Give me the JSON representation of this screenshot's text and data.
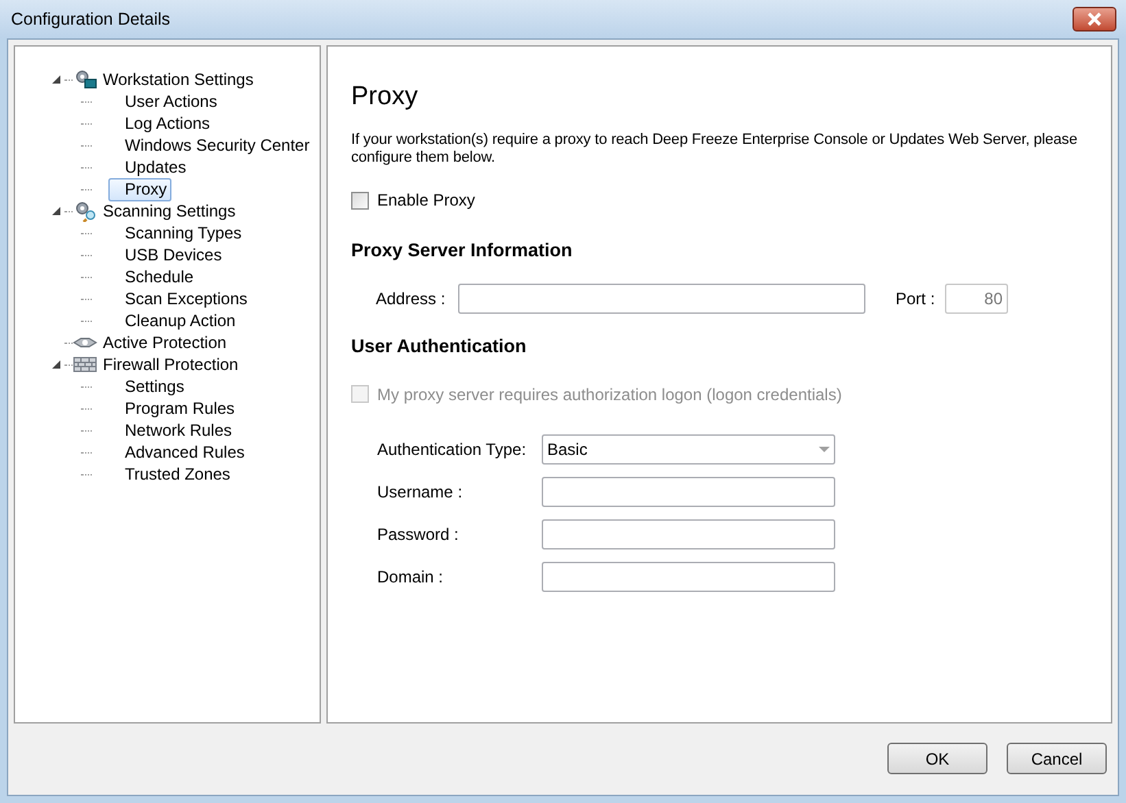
{
  "window": {
    "title": "Configuration Details"
  },
  "tree": [
    {
      "label": "Workstation Settings",
      "kind": "workstation",
      "expanded": true,
      "selected": false,
      "children": [
        {
          "label": "User Actions",
          "selected": false
        },
        {
          "label": "Log Actions",
          "selected": false
        },
        {
          "label": "Windows Security Center",
          "selected": false
        },
        {
          "label": "Updates",
          "selected": false
        },
        {
          "label": "Proxy",
          "selected": true
        }
      ]
    },
    {
      "label": "Scanning Settings",
      "kind": "scanning",
      "expanded": true,
      "selected": false,
      "children": [
        {
          "label": "Scanning Types",
          "selected": false
        },
        {
          "label": "USB Devices",
          "selected": false
        },
        {
          "label": "Schedule",
          "selected": false
        },
        {
          "label": "Scan Exceptions",
          "selected": false
        },
        {
          "label": "Cleanup Action",
          "selected": false
        }
      ]
    },
    {
      "label": "Active Protection",
      "kind": "active",
      "selected": false
    },
    {
      "label": "Firewall Protection",
      "kind": "firewall",
      "expanded": true,
      "selected": false,
      "children": [
        {
          "label": "Settings",
          "selected": false
        },
        {
          "label": "Program Rules",
          "selected": false
        },
        {
          "label": "Network Rules",
          "selected": false
        },
        {
          "label": "Advanced Rules",
          "selected": false
        },
        {
          "label": "Trusted Zones",
          "selected": false
        }
      ]
    }
  ],
  "page": {
    "title": "Proxy",
    "description": "If your workstation(s) require a proxy to reach Deep Freeze Enterprise Console or Updates Web Server, please configure them  below.",
    "enable_proxy": {
      "label": "Enable Proxy",
      "checked": false,
      "disabled": false
    },
    "server_heading": "Proxy Server Information",
    "address": {
      "label": "Address :"
    },
    "port": {
      "label": "Port :",
      "value": "80",
      "disabled": true
    },
    "auth_heading": "User Authentication",
    "auth_required": {
      "label": "My proxy server requires authorization logon (logon credentials)",
      "checked": false,
      "disabled": true
    },
    "auth_fields": [
      {
        "kind": "dropdown",
        "label": "Authentication Type:",
        "value": "Basic"
      },
      {
        "kind": "text",
        "label": "Username :"
      },
      {
        "kind": "text",
        "label": "Password :"
      },
      {
        "kind": "text",
        "label": "Domain :"
      }
    ]
  },
  "buttons": [
    "OK",
    "Cancel"
  ]
}
